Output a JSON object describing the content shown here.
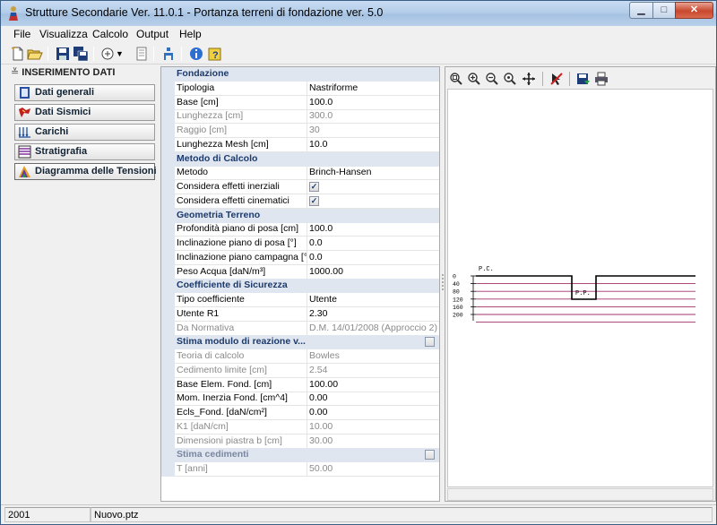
{
  "window": {
    "title": "Strutture Secondarie Ver. 11.0.1 - Portanza terreni di fondazione ver. 5.0"
  },
  "menu": [
    {
      "label": "File",
      "name": "menu-file"
    },
    {
      "label": "Visualizza",
      "name": "menu-visualizza"
    },
    {
      "label": "Calcolo",
      "name": "menu-calcolo"
    },
    {
      "label": "Output",
      "name": "menu-output"
    },
    {
      "label": "Help",
      "name": "menu-help"
    }
  ],
  "nav": {
    "header": "INSERIMENTO DATI",
    "items": [
      {
        "label": "Dati generali",
        "icon": "notebook-icon"
      },
      {
        "label": "Dati Sismici",
        "icon": "seismic-icon"
      },
      {
        "label": "Carichi",
        "icon": "loads-icon"
      },
      {
        "label": "Stratigrafia",
        "icon": "stratigraphy-icon"
      },
      {
        "label": "Diagramma delle Tensioni",
        "icon": "stress-diagram-icon"
      }
    ]
  },
  "grid": {
    "rows": [
      {
        "type": "cat",
        "label": "Fondazione"
      },
      {
        "label": "Tipologia",
        "value": "Nastriforme"
      },
      {
        "label": "Base [cm]",
        "value": "100.0"
      },
      {
        "label": "Lunghezza [cm]",
        "value": "300.0",
        "disabled": true
      },
      {
        "label": "Raggio [cm]",
        "value": "30",
        "disabled": true
      },
      {
        "label": "Lunghezza Mesh [cm]",
        "value": "10.0"
      },
      {
        "type": "cat",
        "label": "Metodo di Calcolo"
      },
      {
        "label": "Metodo",
        "value": "Brinch-Hansen"
      },
      {
        "label": "Considera effetti inerziali",
        "check": true
      },
      {
        "label": "Considera effetti cinematici",
        "check": true
      },
      {
        "type": "cat",
        "label": "Geometria Terreno"
      },
      {
        "label": "Profondità piano di posa [cm]",
        "value": "100.0"
      },
      {
        "label": "Inclinazione piano di posa [°]",
        "value": "0.0"
      },
      {
        "label": "Inclinazione piano campagna [°]",
        "value": "0.0"
      },
      {
        "label": "Peso Acqua [daN/m³]",
        "value": "1000.00"
      },
      {
        "type": "cat",
        "label": "Coefficiente di Sicurezza"
      },
      {
        "label": "Tipo coefficiente",
        "value": "Utente"
      },
      {
        "label": "Utente R1",
        "value": "2.30"
      },
      {
        "label": "Da Normativa",
        "value": "D.M. 14/01/2008 (Approccio 2)",
        "disabled": true
      },
      {
        "type": "cat",
        "label": "Stima modulo di reazione v...",
        "catcheck": false
      },
      {
        "label": "Teoria di calcolo",
        "value": "Bowles",
        "disabled": true
      },
      {
        "label": "Cedimento limite [cm]",
        "value": "2.54",
        "disabled": true
      },
      {
        "label": "Base Elem. Fond.  [cm]",
        "value": "100.00"
      },
      {
        "label": "Mom. Inerzia Fond. [cm^4]",
        "value": "0.00"
      },
      {
        "label": "Ecls_Fond. [daN/cm²]",
        "value": "0.00"
      },
      {
        "label": "K1 [daN/cm]",
        "value": "10.00",
        "disabled": true
      },
      {
        "label": "Dimensioni piastra b [cm]",
        "value": "30.00",
        "disabled": true
      },
      {
        "type": "cat",
        "label": "Stima cedimenti",
        "catcheck": false,
        "muted": true
      },
      {
        "label": "T [anni]",
        "value": "50.00",
        "disabled": true
      }
    ]
  },
  "drawing": {
    "pc_label": "P.C.",
    "pp_label": "P.P.",
    "depth_ticks": [
      "0",
      "40",
      "80",
      "120",
      "160",
      "200"
    ]
  },
  "status": {
    "year": "2001",
    "file": "Nuovo.ptz"
  }
}
